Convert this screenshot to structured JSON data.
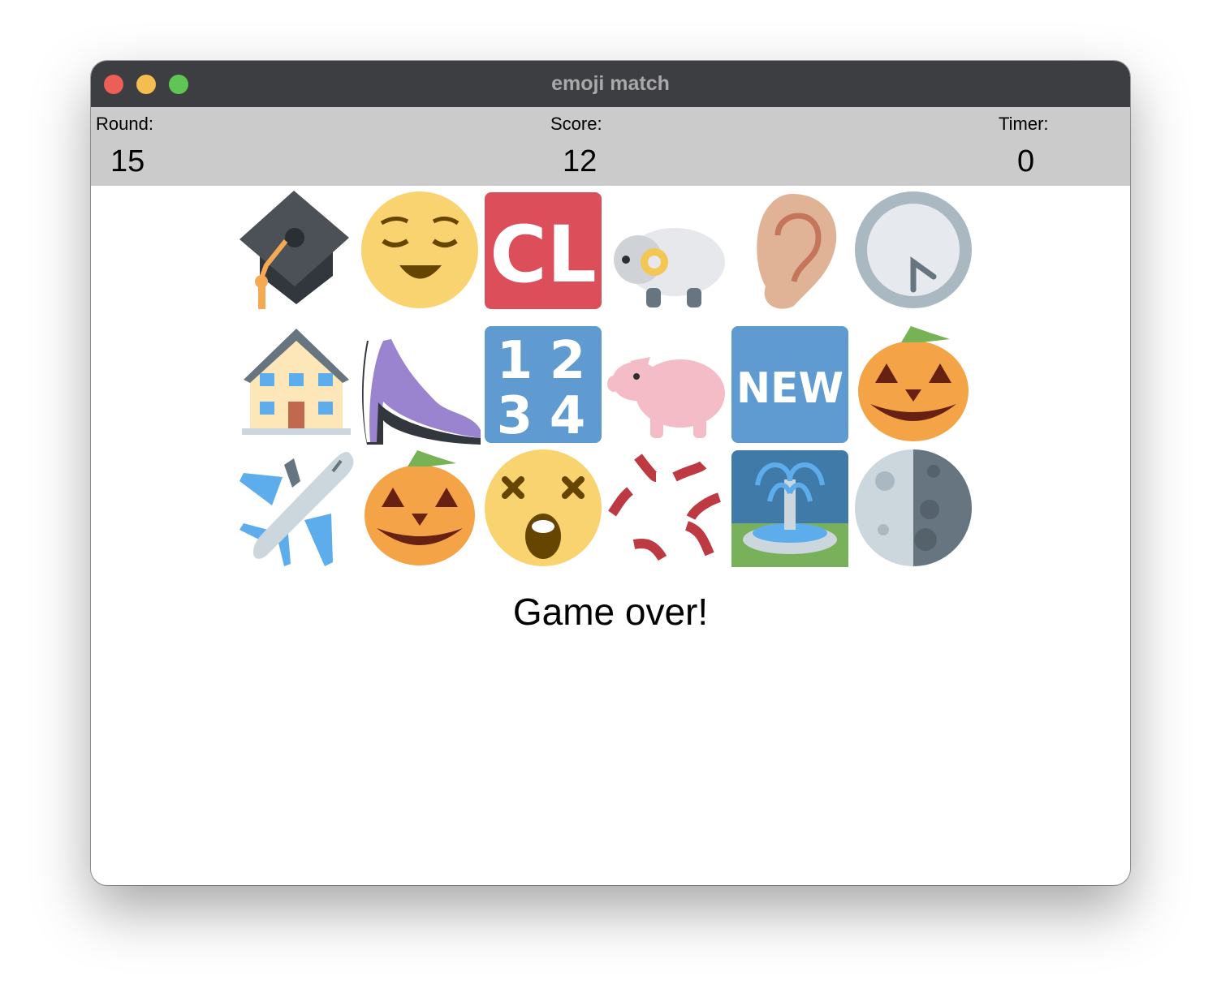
{
  "window": {
    "title": "emoji match"
  },
  "status": {
    "round_label": "Round:",
    "round_value": "15",
    "score_label": "Score:",
    "score_value": "12",
    "timer_label": "Timer:",
    "timer_value": "0"
  },
  "board": {
    "rows": [
      [
        "graduation-cap-icon",
        "relieved-face-icon",
        "cl-button-icon",
        "ram-icon",
        "ear-icon",
        "clock-icon"
      ],
      [
        "house-icon",
        "high-heel-icon",
        "input-numbers-icon",
        "pig-icon",
        "new-button-icon",
        "jack-o-lantern-icon"
      ],
      [
        "airplane-icon",
        "jack-o-lantern-icon",
        "dizzy-face-icon",
        "anger-symbol-icon",
        "fountain-icon",
        "last-quarter-moon-icon"
      ]
    ]
  },
  "message": "Game over!",
  "colors": {
    "titlebar": "#3d3e41",
    "statusbar": "#cbcbcb",
    "close": "#ec5f57",
    "minimize": "#f4bd4f",
    "maximize": "#5fc554"
  }
}
